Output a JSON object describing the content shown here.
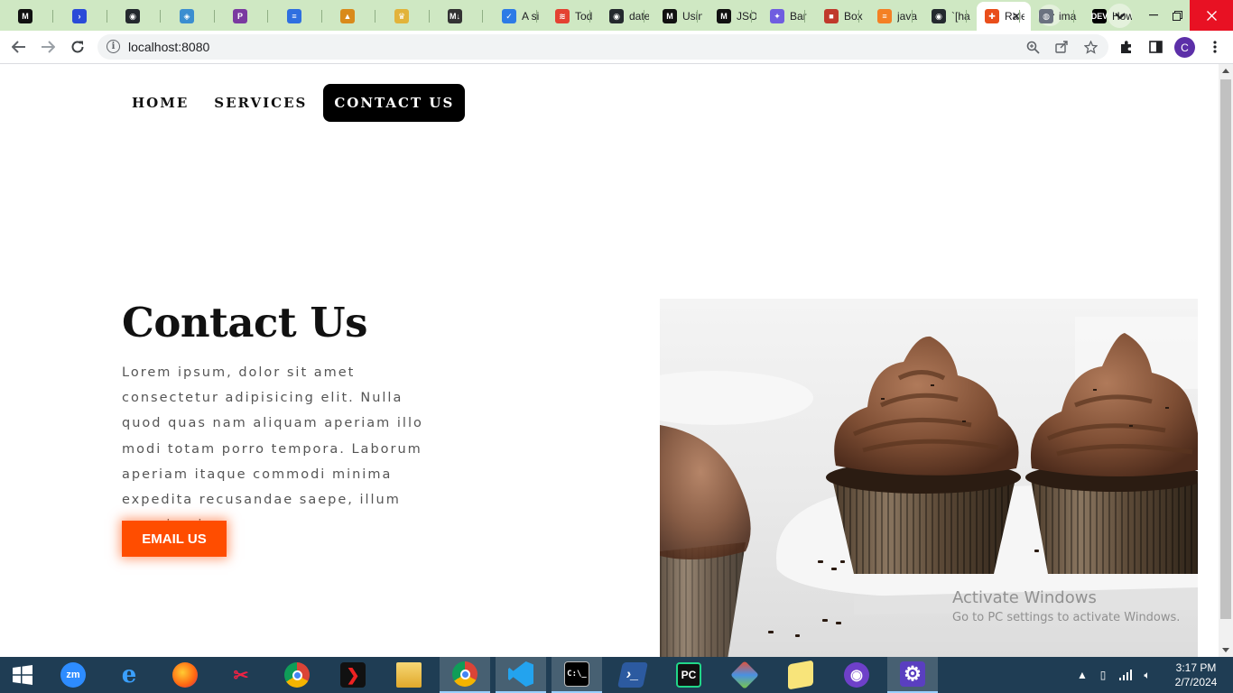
{
  "browser": {
    "tabs": [
      {
        "icon": "medium-icon",
        "title": "",
        "color": "#111111",
        "glyph": "M"
      },
      {
        "icon": "powershell-icon",
        "title": "",
        "color": "#2a4bd8",
        "glyph": "›"
      },
      {
        "icon": "github-icon",
        "title": "",
        "color": "#24292e",
        "glyph": "◉"
      },
      {
        "icon": "chrome-extension-icon",
        "title": "",
        "color": "#3b8ed0",
        "glyph": "◈"
      },
      {
        "icon": "podcast-icon",
        "title": "",
        "color": "#7a3aa0",
        "glyph": "P"
      },
      {
        "icon": "forms-icon",
        "title": "",
        "color": "#2f6fe0",
        "glyph": "≡"
      },
      {
        "icon": "storage-icon",
        "title": "",
        "color": "#d98a1a",
        "glyph": "▲"
      },
      {
        "icon": "crown-icon",
        "title": "",
        "color": "#e2b33a",
        "glyph": "♛"
      },
      {
        "icon": "markdown-icon",
        "title": "",
        "color": "#333333",
        "glyph": "M↓"
      },
      {
        "icon": "todo-icon",
        "title": "A si",
        "color": "#2d7be6",
        "glyph": "✓"
      },
      {
        "icon": "todoist-icon",
        "title": "Tod",
        "color": "#e44232",
        "glyph": "≋"
      },
      {
        "icon": "github-icon",
        "title": "date",
        "color": "#24292e",
        "glyph": "◉"
      },
      {
        "icon": "medium-icon",
        "title": "Usin",
        "color": "#111111",
        "glyph": "M"
      },
      {
        "icon": "medium-icon",
        "title": "JSO",
        "color": "#111111",
        "glyph": "M"
      },
      {
        "icon": "bard-icon",
        "title": "Bar",
        "color": "#6f5de0",
        "glyph": "✦"
      },
      {
        "icon": "box-icon",
        "title": "Box",
        "color": "#c0392b",
        "glyph": "■"
      },
      {
        "icon": "stackoverflow-icon",
        "title": "java",
        "color": "#f48024",
        "glyph": "≡"
      },
      {
        "icon": "github-icon",
        "title": "`[ha",
        "color": "#24292e",
        "glyph": "◉"
      },
      {
        "icon": "rails-icon",
        "title": "Rale",
        "color": "#e94e1b",
        "glyph": "✚"
      },
      {
        "icon": "globe-icon",
        "title": "ima",
        "color": "#6b7280",
        "glyph": "◍"
      },
      {
        "icon": "dev-icon",
        "title": "How",
        "color": "#000000",
        "glyph": "DEV"
      }
    ],
    "active_tab": {
      "icon": "cutlery-icon",
      "glyph": "✕"
    },
    "new_tab_label": "+",
    "url": "localhost:8080",
    "profile_initial": "C"
  },
  "page": {
    "nav": {
      "home": "HOME",
      "services": "SERVICES",
      "contact": "CONTACT US"
    },
    "title": "Contact Us",
    "body": "Lorem ipsum, dolor sit amet consectetur adipisicing elit. Nulla quod quas nam aliquam aperiam illo modi totam porro tempora. Laborum aperiam itaque commodi minima expedita recusandae saepe, illum magni qui.",
    "button": "EMAIL US",
    "accent": "#ff4d00",
    "image": "chocolate-cupcakes"
  },
  "os": {
    "watermark_title": "Activate Windows",
    "watermark_sub": "Go to PC settings to activate Windows.",
    "time": "3:17 PM",
    "date": "2/7/2024"
  }
}
